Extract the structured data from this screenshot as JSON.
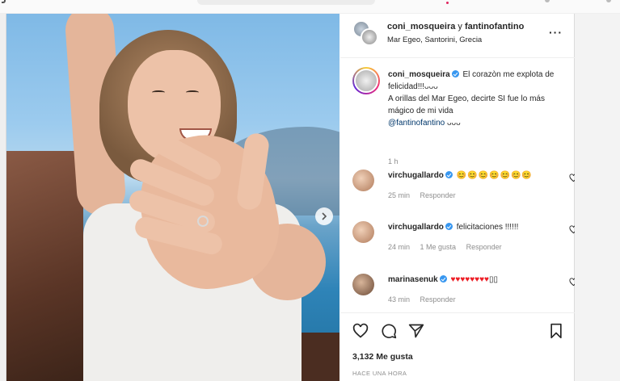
{
  "post": {
    "header": {
      "author1": "coni_mosqueira",
      "connector": "y",
      "author2": "fantinofantino",
      "location": "Mar Egeo, Santorini, Grecia",
      "more_icon": "more-horizontal-icon"
    },
    "caption": {
      "username": "coni_mosqueira",
      "line1": "El corazòn me explota de felicidad!!!ᴗᴗᴗ",
      "line2": "A orillas del Mar Egeo, decirte SI fue lo más mágico de mi vida",
      "mention": "@fantinofantino",
      "emoji_tail": "ᴗᴗᴗ",
      "time": "1 h"
    },
    "comments": [
      {
        "username": "virchugallardo",
        "text": "😊😊😊😊😊😊😊",
        "time": "25 min",
        "likes": "",
        "reply": "Responder"
      },
      {
        "username": "virchugallardo",
        "text": "felicitaciones !!!!!!",
        "time": "24 min",
        "likes": "1 Me gusta",
        "reply": "Responder"
      },
      {
        "username": "marinasenuk",
        "text": "♥♥♥♥♥♥♥♥",
        "tail": "▯▯",
        "time": "43 min",
        "likes": "",
        "reply": "Responder"
      }
    ],
    "actions": {
      "like_icon": "heart-icon",
      "comment_icon": "comment-icon",
      "share_icon": "send-icon",
      "save_icon": "bookmark-icon"
    },
    "likes_count": "3,132 Me gusta",
    "posted_when": "HACE UNA HORA",
    "colors": {
      "verified": "#3897f0",
      "mention": "#00376b",
      "muted": "#8e8e8e"
    }
  }
}
